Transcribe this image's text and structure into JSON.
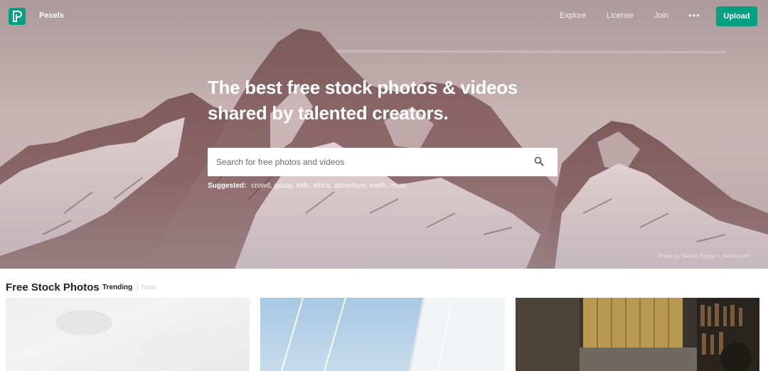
{
  "nav": {
    "brand": "Pexels",
    "links": [
      "Explore",
      "License",
      "Join"
    ],
    "more": "•••",
    "upload": "Upload"
  },
  "hero": {
    "headline_line1": "The best free stock photos & videos",
    "headline_line2": "shared by talented creators.",
    "search_placeholder": "Search for free photos and videos",
    "suggested_label": "Suggested:",
    "suggested_tags": [
      "crowd",
      "group",
      "kids",
      "africa",
      "adventure",
      "earth",
      "more"
    ],
    "credit": "Photo by Simon Berger • pexels.com"
  },
  "section": {
    "title": "Free Stock Photos",
    "tab_trending": "Trending",
    "separator": "|",
    "tab_new": "New"
  },
  "colors": {
    "accent": "#05a081",
    "hero_sky": "#c2aeaf",
    "text_dark": "#222222"
  }
}
